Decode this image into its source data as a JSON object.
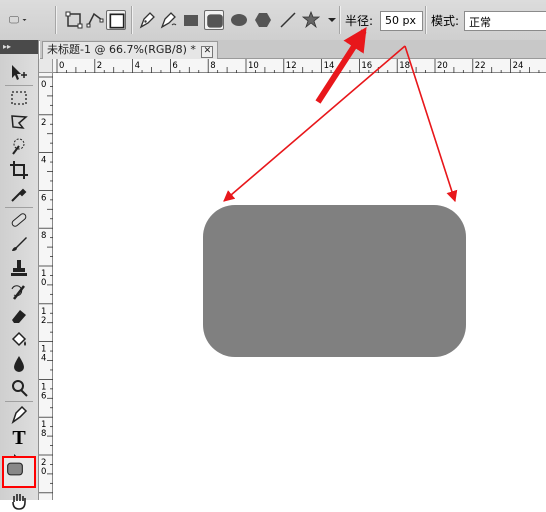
{
  "options_bar": {
    "radius_label": "半径:",
    "radius_value": "50 px",
    "mode_label": "模式:",
    "mode_value": "正常"
  },
  "document": {
    "tab_title": "未标题-1 @ 66.7%(RGB/8) *",
    "close_glyph": "✕"
  },
  "toolbox": {
    "collapse_glyph": "▸▸",
    "type_tool_glyph": "T"
  },
  "rulers": {
    "horizontal_ticks": [
      "0",
      "2",
      "4",
      "6",
      "8",
      "10",
      "12",
      "14",
      "16",
      "18",
      "20",
      "22",
      "24"
    ],
    "vertical_ticks": [
      "0",
      "2",
      "4",
      "6",
      "8",
      "10",
      "12",
      "14",
      "16",
      "18",
      "20"
    ]
  },
  "colors": {
    "shape_fill": "#808080",
    "annotation": "#e8171b",
    "highlight": "#ff0000"
  }
}
